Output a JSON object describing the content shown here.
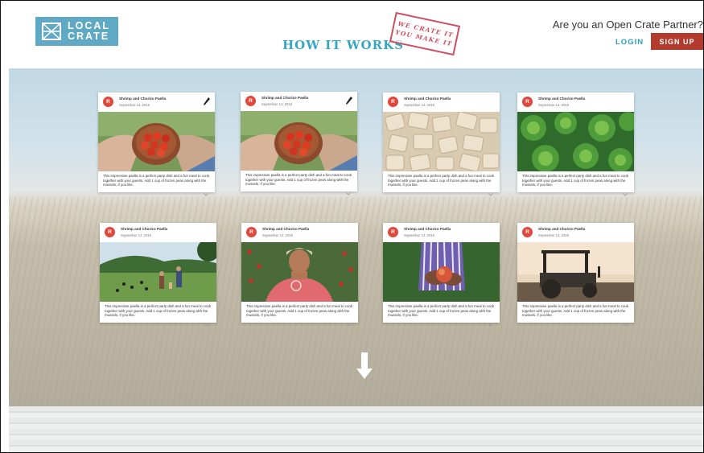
{
  "header": {
    "logo_line1": "LOCAL",
    "logo_line2": "CRATE",
    "title": "HOW IT WORKS",
    "stamp_line1": "WE CRATE IT",
    "stamp_line2": "YOU MAKE IT",
    "partner_question": "Are you an Open Crate Partner?",
    "login_label": "LOGIN",
    "signup_label": "SIGN UP"
  },
  "colors": {
    "logo_bg": "#5fa9c4",
    "title": "#35a6c4",
    "signup_bg": "#b33b2e",
    "avatar": "#e0483d",
    "stamp": "#d04e5e"
  },
  "cards": [
    {
      "avatar": "R",
      "title": "Shrimp and Chorizo Paella",
      "date": "September 14, 2016",
      "desc": "This impressive paella is a perfect party dish and a fun meal to cook together with your guests. Add 1 cup of frozen peas along with the mussels, if you like.",
      "image": "tomatoes-bowl",
      "editable": true
    },
    {
      "avatar": "R",
      "title": "Shrimp and Chorizo Paella",
      "date": "September 14, 2016",
      "desc": "This impressive paella is a perfect party dish and a fun meal to cook together with your guests. Add 1 cup of frozen peas along with the mussels, if you like.",
      "image": "tomatoes-bowl",
      "editable": true
    },
    {
      "avatar": "R",
      "title": "Shrimp and Chorizo Paella",
      "date": "September 14, 2016",
      "desc": "This impressive paella is a perfect party dish and a fun meal to cook together with your guests. Add 1 cup of frozen peas along with the mussels, if you like.",
      "image": "ravioli",
      "editable": false
    },
    {
      "avatar": "R",
      "title": "Shrimp and Chorizo Paella",
      "date": "September 14, 2016",
      "desc": "This impressive paella is a perfect party dish and a fun meal to cook together with your guests. Add 1 cup of frozen peas along with the mussels, if you like.",
      "image": "lettuce",
      "editable": false
    },
    {
      "avatar": "R",
      "title": "Shrimp and Chorizo Paella",
      "date": "September 14, 2016",
      "desc": "This impressive paella is a perfect party dish and a fun meal to cook together with your guests. Add 1 cup of frozen peas along with the mussels, if you like.",
      "image": "farm-walk",
      "editable": false
    },
    {
      "avatar": "R",
      "title": "Shrimp and Chorizo Paella",
      "date": "September 14, 2016",
      "desc": "This impressive paella is a perfect party dish and a fun meal to cook together with your guests. Add 1 cup of frozen peas along with the mussels, if you like.",
      "image": "farmer-woman",
      "editable": false
    },
    {
      "avatar": "R",
      "title": "Shrimp and Chorizo Paella",
      "date": "September 14, 2016",
      "desc": "This impressive paella is a perfect party dish and a fun meal to cook together with your guests. Add 1 cup of frozen peas along with the mussels, if you like.",
      "image": "hands-apple",
      "editable": false
    },
    {
      "avatar": "R",
      "title": "Shrimp and Chorizo Paella",
      "date": "September 14, 2016",
      "desc": "This impressive paella is a perfect party dish and a fun meal to cook together with your guests. Add 1 cup of frozen peas along with the mussels, if you like.",
      "image": "tractor",
      "editable": false
    }
  ],
  "scroll_icon": "down-arrow-icon"
}
